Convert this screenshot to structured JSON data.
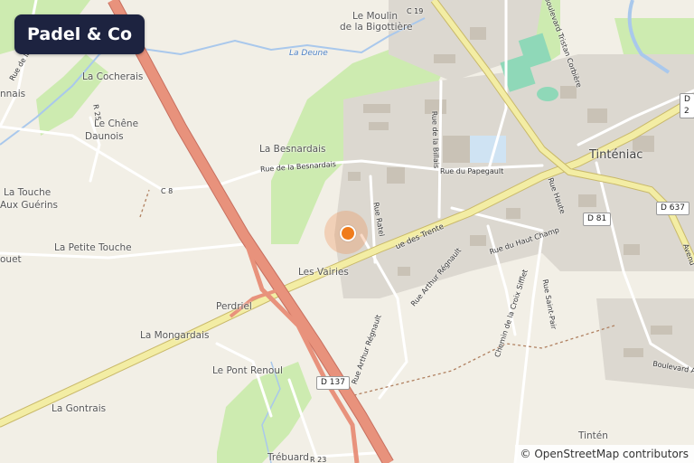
{
  "app": {
    "title": "Padel & Co"
  },
  "attribution": "© OpenStreetMap contributors",
  "marker": {
    "icon": "location-pin-icon",
    "color": "#f07c1c"
  },
  "colors": {
    "motorway": "#e8927c",
    "main_road": "#f3eda4",
    "water": "#a9c8ec",
    "wood": "#cdebb0",
    "built": "#dcd8d0"
  },
  "places": {
    "le_moulin_line1": "Le Moulin",
    "le_moulin_line2": "de la Bigottière",
    "la_cocherais": "La Cocherais",
    "le_chene_line1": "Le Chêne",
    "le_chene_line2": "Daunois",
    "la_besnardais": "La Besnardais",
    "la_touche_line1": "La Touche",
    "la_touche_line2": "Aux Guérins",
    "la_petite_touche": "La Petite Touche",
    "les_vairies": "Les Vairies",
    "perdriel": "Perdriel",
    "la_mongardais": "La Mongardais",
    "le_pont_renoul": "Le Pont Renoul",
    "la_gontrais": "La Gontrais",
    "trebuard": "Trébuard",
    "tinteniac": "Tinténiac",
    "tinteniac_bottom": "Tintén",
    "nnais": "nnais",
    "ouet": "ouet"
  },
  "water": {
    "la_deune": "La Deune"
  },
  "roads": {
    "rue_besnardais": "Rue de la Besnardais",
    "rue_papegault": "Rue du Papegault",
    "rue_billais": "Rue de la Billais",
    "rue_ratel": "Rue Ratel",
    "rue_des_trente": "ue des Trente",
    "rue_haut_champ": "Rue du Haut Champ",
    "rue_arthur_1": "Rue Arthur Régnault",
    "rue_arthur_2": "Rue Arthur Régnault",
    "chemin_croix": "Chemin de la Croix Sifflet",
    "rue_saint_pair": "Rue Saint-Pair",
    "rue_haute": "Rue Haute",
    "boulevard_tristan": "Boulevard Tristan Corbière",
    "boulevard_al": "Boulevard Al",
    "avenue": "Avenu",
    "rue_de_la_go": "Rue de la Go",
    "c8": "C 8",
    "c19": "C 19",
    "r25": "R 25",
    "r23": "R 23"
  },
  "shields": {
    "d137": "D 137",
    "d81": "D 81",
    "d637": "D 637",
    "d2": "D 2"
  }
}
